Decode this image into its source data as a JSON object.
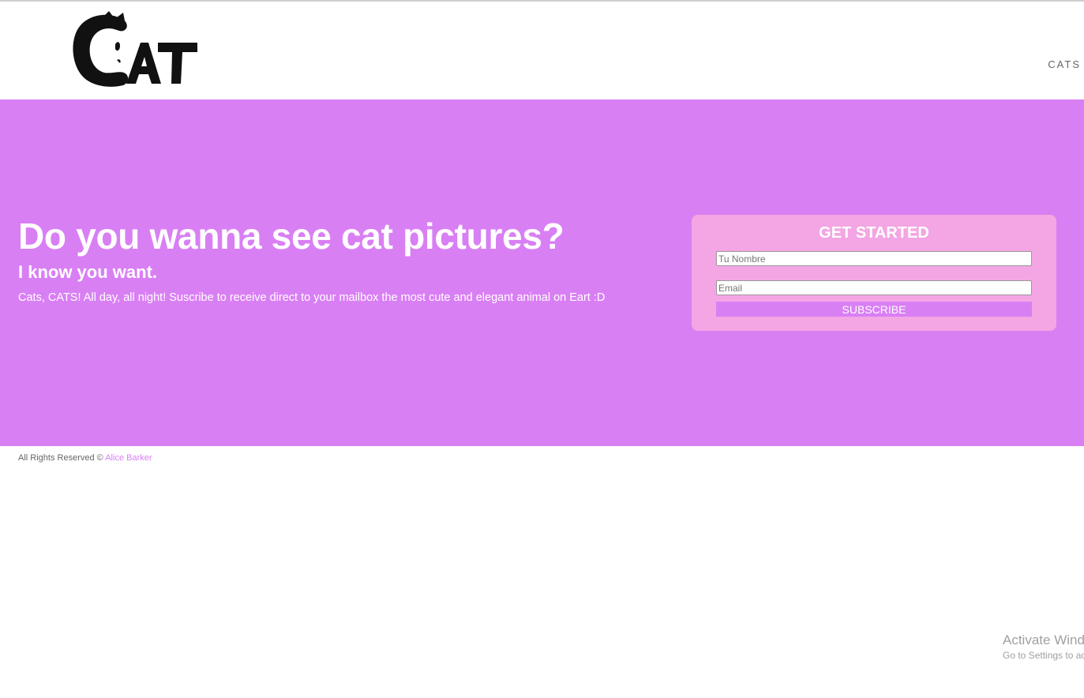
{
  "header": {
    "logo_text": "CAT",
    "nav_link": "CATS"
  },
  "hero": {
    "title": "Do you wanna see cat pictures?",
    "subtitle": "I know you want.",
    "text": "Cats, CATS! All day, all night! Suscribe to receive direct to your mailbox the most cute and elegant animal on Eart :D"
  },
  "form": {
    "title": "GET STARTED",
    "name_placeholder": "Tu Nombre",
    "email_placeholder": "Email",
    "subscribe_label": "SUBSCRIBE"
  },
  "footer": {
    "rights": "All Rights Reserved © ",
    "author": "Alice Barker"
  },
  "watermark": {
    "title": "Activate Windows",
    "subtitle": "Go to Settings to activate Windows."
  },
  "colors": {
    "accent": "#d97ff4",
    "card": "#f3a6e3",
    "text_light": "#ffffff",
    "footer_text": "#666666"
  }
}
